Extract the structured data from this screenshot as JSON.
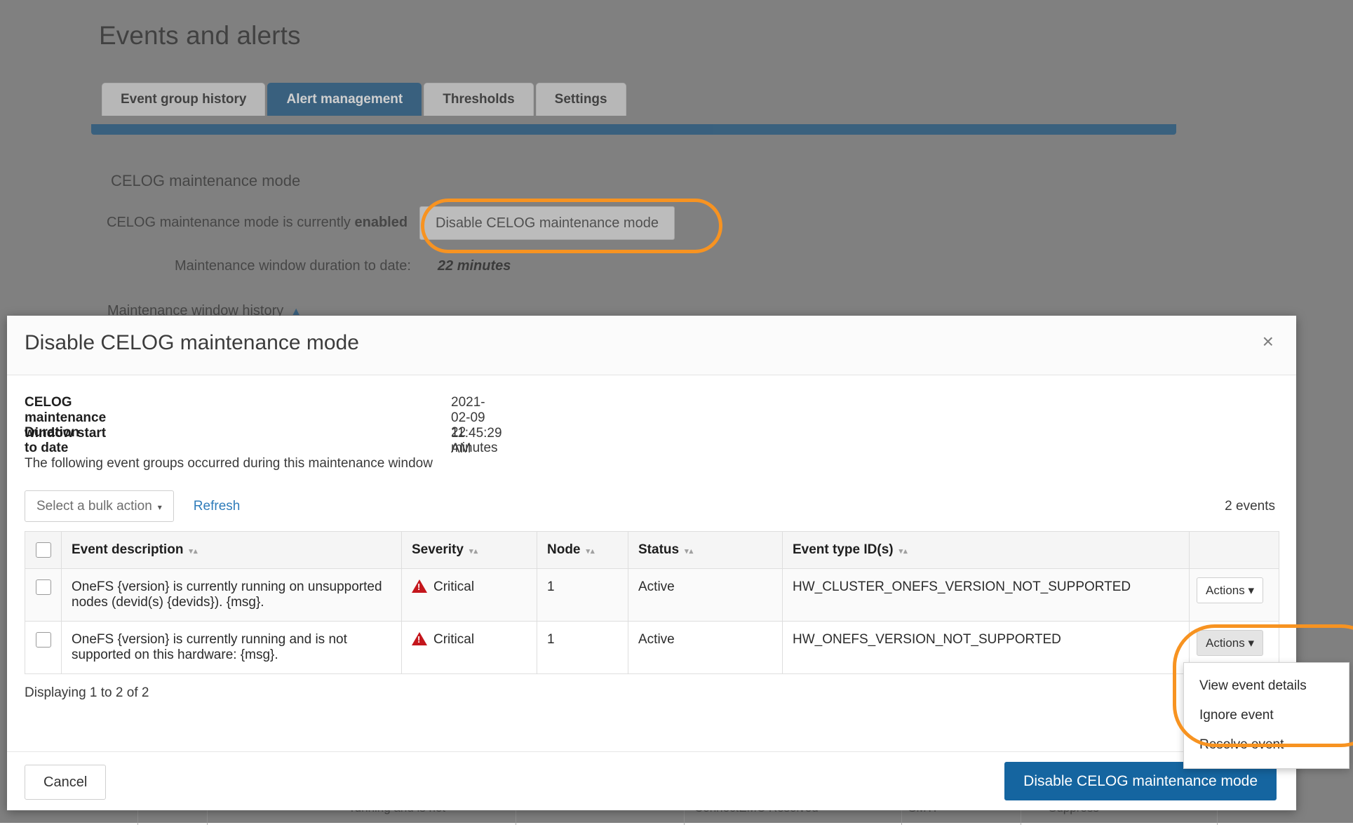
{
  "page": {
    "title": "Events and alerts",
    "tabs": [
      {
        "label": "Event group history",
        "active": false
      },
      {
        "label": "Alert management",
        "active": true
      },
      {
        "label": "Thresholds",
        "active": false
      },
      {
        "label": "Settings",
        "active": false
      }
    ],
    "section_heading": "CELOG maintenance mode",
    "status_prefix": "CELOG maintenance mode is currently ",
    "status_state": "enabled",
    "disable_button_label": "Disable CELOG maintenance mode",
    "duration_label": "Maintenance window duration to date:",
    "duration_value": "22 minutes",
    "history_label": "Maintenance window history",
    "history_caret": "▲",
    "background_bottom_row": {
      "description_fragment": "running and is not",
      "channel": "ConnectEMC Resolved",
      "smtp": "SMTP",
      "suppress_fragment": "Suppress"
    }
  },
  "dialog": {
    "title": "Disable CELOG maintenance mode",
    "close_label": "×",
    "details": [
      {
        "label": "CELOG maintenance window start",
        "value": "2021-02-09 11:45:29 AM"
      },
      {
        "label": "Duration to date",
        "value": "22 minutes"
      }
    ],
    "intro_text": "The following event groups occurred during this maintenance window",
    "toolbar": {
      "bulk_action_label": "Select a bulk action",
      "caret": "▾",
      "refresh_label": "Refresh",
      "events_count": "2 events"
    },
    "table": {
      "columns": [
        {
          "key": "checkbox",
          "label": ""
        },
        {
          "key": "description",
          "label": "Event description",
          "sortable": true
        },
        {
          "key": "severity",
          "label": "Severity",
          "sortable": true
        },
        {
          "key": "node",
          "label": "Node",
          "sortable": true
        },
        {
          "key": "status",
          "label": "Status",
          "sortable": true
        },
        {
          "key": "event_type",
          "label": "Event type ID(s)",
          "sortable": true
        },
        {
          "key": "actions",
          "label": ""
        }
      ],
      "sort_arrows": "▾▴",
      "rows": [
        {
          "description": "OneFS {version} is currently running on unsupported nodes (devid(s) {devids}). {msg}.",
          "severity": "Critical",
          "severity_icon": "warning-triangle-icon",
          "node": "1",
          "status": "Active",
          "event_type": "HW_CLUSTER_ONEFS_VERSION_NOT_SUPPORTED",
          "actions_label": "Actions",
          "actions_open": false
        },
        {
          "description": "OneFS {version} is currently running and is not supported on this hardware: {msg}.",
          "severity": "Critical",
          "severity_icon": "warning-triangle-icon",
          "node": "1",
          "status": "Active",
          "event_type": "HW_ONEFS_VERSION_NOT_SUPPORTED",
          "actions_label": "Actions",
          "actions_open": true
        }
      ]
    },
    "displaying": "Displaying 1 to 2 of 2",
    "footer": {
      "cancel_label": "Cancel",
      "primary_label": "Disable CELOG maintenance mode"
    }
  },
  "actions_menu": {
    "items": [
      {
        "label": "View event details"
      },
      {
        "label": "Ignore event"
      },
      {
        "label": "Resolve event"
      }
    ]
  },
  "colors": {
    "accent_blue": "#0e4d7d",
    "primary_button": "#1565a0",
    "highlight_orange": "#f79321",
    "critical_red": "#c4161c",
    "link_blue": "#2f7cba"
  }
}
